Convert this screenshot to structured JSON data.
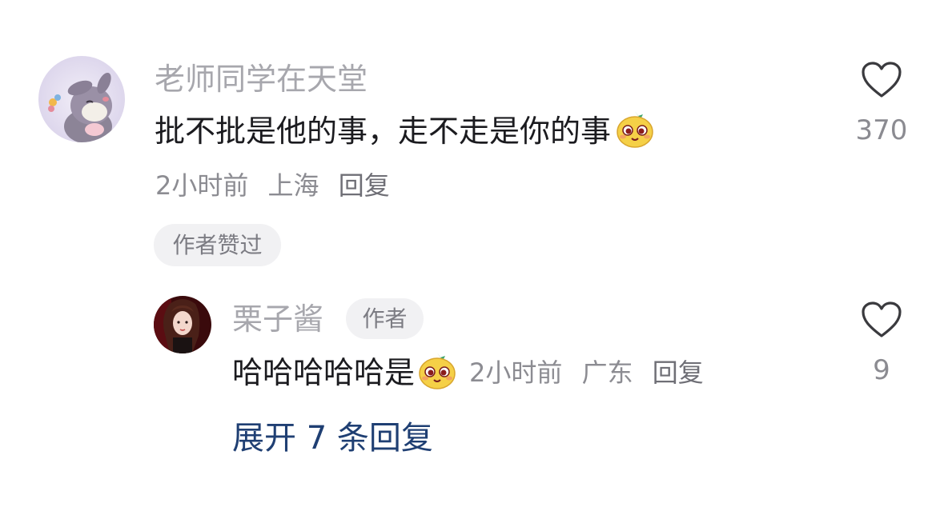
{
  "comment": {
    "username": "老师同学在天堂",
    "text": "批不批是他的事，走不走是你的事",
    "time": "2小时前",
    "location": "上海",
    "reply_label": "回复",
    "badge": "作者赞过",
    "like_count": "370",
    "emoji": "mango-smile-emoji"
  },
  "reply": {
    "username": "栗子酱",
    "author_tag": "作者",
    "text": "哈哈哈哈哈是",
    "time": "2小时前",
    "location": "广东",
    "reply_label": "回复",
    "like_count": "9",
    "emoji": "mango-smile-emoji"
  },
  "expand_label": "展开 7 条回复",
  "colors": {
    "expand_link": "#1f3f73",
    "username": "#a7a7ad",
    "content": "#1b1b1f"
  }
}
